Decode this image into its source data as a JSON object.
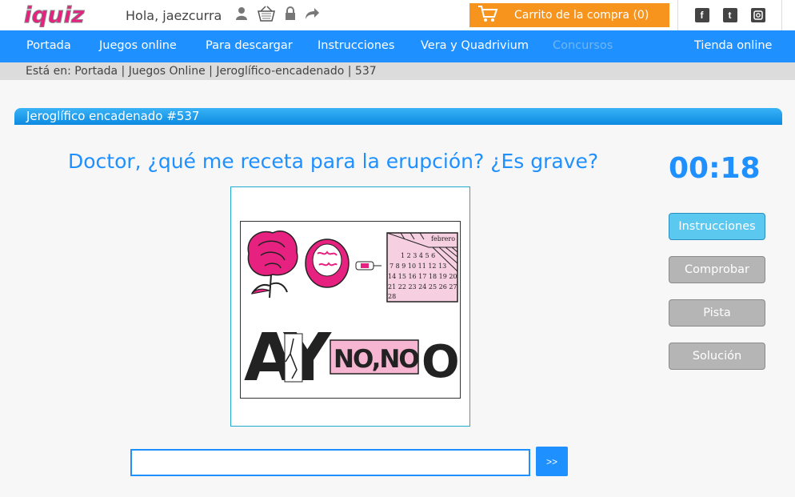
{
  "brand": {
    "logo_text": "iquiz",
    "accent": "#1e90ff",
    "logo_color": "#e6217f",
    "cart_color": "#f7941d"
  },
  "header": {
    "greeting": "Hola, jaezcurra",
    "icons": [
      "user-icon",
      "basket-icon",
      "lock-icon",
      "logout-arrow-icon"
    ],
    "cart_label": "Carrito de la compra (0)",
    "social": [
      "facebook-icon",
      "twitter-icon",
      "instagram-icon"
    ]
  },
  "nav": {
    "items": [
      {
        "label": "Portada"
      },
      {
        "label": "Juegos online"
      },
      {
        "label": "Para descargar"
      },
      {
        "label": "Instrucciones"
      },
      {
        "label": "Vera y Quadrivium"
      },
      {
        "label": "Concursos",
        "disabled": true
      },
      {
        "label": "Tienda online"
      }
    ]
  },
  "breadcrumb": "Está en: Portada | Juegos Online | Jeroglífico-encadenado | 537",
  "game": {
    "title": "Jeroglífico encadenado #537",
    "question": "Doctor, ¿qué me receta para la erupción? ¿Es grave?",
    "timer": "00:18",
    "buttons": {
      "instructions": "Instrucciones",
      "check": "Comprobar",
      "hint": "Pista",
      "solution": "Solución"
    },
    "answer_value": "",
    "submit_label": ">>",
    "puzzle": {
      "calendar_month": "febrero",
      "calendar_rows": [
        "1 2 3 4 5 6",
        "7 8 9 10 11 12 13",
        "14 15 16 17 18 19 20",
        "21 22 23 24 25 26 27",
        "28"
      ],
      "big_letters_1": "AY",
      "pink_text": "NO,NO",
      "big_letter_2": "O"
    }
  }
}
